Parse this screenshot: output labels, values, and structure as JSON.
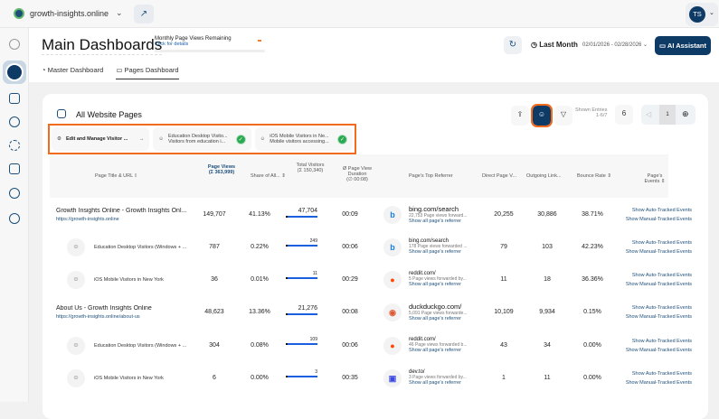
{
  "topbar": {
    "site": "growth-insights.online",
    "avatar": "TS"
  },
  "sidebar": {
    "icons": [
      "collapse-icon",
      "dashboard-icon",
      "bag-icon",
      "chart-icon",
      "target-icon",
      "chat-icon",
      "shield-check-icon",
      "settings-icon"
    ]
  },
  "header": {
    "title": "Main Dashboards",
    "quota_label": "Monthly Page Views Remaining",
    "quota_link": "Click for details",
    "period": "Last Month",
    "range": "02/01/2026 - 02/28/2026",
    "ai_label": "AI Assistant",
    "tabs": [
      {
        "label": "Master Dashboard"
      },
      {
        "label": "Pages Dashboard",
        "active": true
      }
    ]
  },
  "card": {
    "title": "All Website Pages",
    "segments": [
      {
        "title": "Edit and Manage Visitor ..."
      },
      {
        "title": "Education Desktop Visito...",
        "sub": "Visitors from education i..."
      },
      {
        "title": "iOS Mobile Visitors in Ne...",
        "sub": "Mobile visitors accessing..."
      }
    ],
    "shown_label": "Shown Entries",
    "shown_range": "1-6/7",
    "per_page": "6",
    "page": "1"
  },
  "columns": {
    "title": "Page Title & URL",
    "views": "Page Views",
    "views_total": "(Σ 363,999)",
    "share": "Share of All...",
    "visitors": "Total Visitors",
    "visitors_total": "(Σ 150,340)",
    "duration": "Ø Page View Duration",
    "duration_avg": "(∅ 00:08)",
    "referrer": "Page's Top Referrer",
    "direct": "Direct Page V...",
    "outgoing": "Outgoing Link...",
    "bounce": "Bounce Rate",
    "events": "Page's Events"
  },
  "links": {
    "all_ref": "Show all page's referrer",
    "auto": "Show Auto-Tracked Events",
    "manual": "Show Manual-Tracked Events"
  },
  "rows": [
    {
      "type": "page",
      "title": "Growth Insights Online - Growth Insights Onl...",
      "url": "https://growth-insights.online",
      "views": "149,707",
      "share": "41.13%",
      "visitors": "47,704",
      "visitors_frac": 1.0,
      "duration": "00:09",
      "ref": "bing.com/search",
      "ref_sub": "22,753 Page views forward...",
      "ref_icon": "bing",
      "direct": "20,255",
      "outgoing": "30,886",
      "bounce": "38.71%"
    },
    {
      "type": "segment",
      "title": "Education Desktop Visitors (Windows + ...",
      "views": "787",
      "share": "0.22%",
      "visitors": "249",
      "visitors_frac": 1.0,
      "duration": "00:06",
      "ref": "bing.com/search",
      "ref_sub": "178 Page views forwarded ...",
      "ref_icon": "bing",
      "direct": "79",
      "outgoing": "103",
      "bounce": "42.23%"
    },
    {
      "type": "segment",
      "title": "iOS Mobile Visitors in New York",
      "views": "36",
      "share": "0.01%",
      "visitors": "11",
      "visitors_frac": 1.0,
      "duration": "00:29",
      "ref": "reddit.com/",
      "ref_sub": "5 Page views forwarded by...",
      "ref_icon": "reddit",
      "direct": "11",
      "outgoing": "18",
      "bounce": "36.36%"
    },
    {
      "type": "page",
      "title": "About Us - Growth Insights Online",
      "url": "https://growth-insights.online/about-us",
      "views": "48,623",
      "share": "13.36%",
      "visitors": "21,276",
      "visitors_frac": 1.0,
      "duration": "00:08",
      "ref": "duckduckgo.com/",
      "ref_sub": "5,091 Page views forwarde...",
      "ref_icon": "duckduckgo",
      "direct": "10,109",
      "outgoing": "9,934",
      "bounce": "0.15%"
    },
    {
      "type": "segment",
      "title": "Education Desktop Visitors (Windows + ...",
      "views": "304",
      "share": "0.08%",
      "visitors": "109",
      "visitors_frac": 1.0,
      "duration": "00:06",
      "ref": "reddit.com/",
      "ref_sub": "46 Page views forwarded b...",
      "ref_icon": "reddit",
      "direct": "43",
      "outgoing": "34",
      "bounce": "0.00%"
    },
    {
      "type": "segment",
      "title": "iOS Mobile Visitors in New York",
      "views": "6",
      "share": "0.00%",
      "visitors": "3",
      "visitors_frac": 1.0,
      "duration": "00:35",
      "ref": "dev.to/",
      "ref_sub": "3 Page views forwarded by...",
      "ref_icon": "devto",
      "direct": "1",
      "outgoing": "11",
      "bounce": "0.00%"
    }
  ],
  "colors": {
    "accent": "#0e3a66",
    "highlight": "#f26b1d",
    "bar": "#1a5fe0",
    "success": "#2aa952"
  }
}
